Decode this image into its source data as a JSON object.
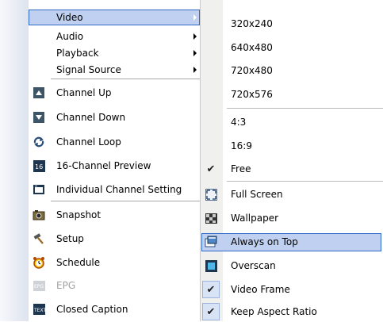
{
  "main_menu": {
    "video": "Video",
    "audio": "Audio",
    "playback": "Playback",
    "signal_source": "Signal Source",
    "channel_up": "Channel Up",
    "channel_down": "Channel Down",
    "channel_loop": "Channel Loop",
    "preview16": "16-Channel Preview",
    "individual": "Individual Channel Setting",
    "snapshot": "Snapshot",
    "setup": "Setup",
    "schedule": "Schedule",
    "epg": "EPG",
    "closed_caption": "Closed Caption"
  },
  "sub_menu": {
    "res1": "320x240",
    "res2": "640x480",
    "res3": "720x480",
    "res4": "720x576",
    "ratio1": "4:3",
    "ratio2": "16:9",
    "free": "Free",
    "full_screen": "Full Screen",
    "wallpaper": "Wallpaper",
    "always_on_top": "Always on Top",
    "overscan": "Overscan",
    "video_frame": "Video Frame",
    "keep_aspect": "Keep Aspect Ratio"
  },
  "icons": {
    "channel_up": "channel-up-icon",
    "channel_down": "channel-down-icon",
    "channel_loop": "channel-loop-icon",
    "preview16": "sixteen-channel-icon",
    "individual": "channel-setting-icon",
    "snapshot": "camera-icon",
    "setup": "hammer-icon",
    "schedule": "alarm-clock-icon",
    "epg": "epg-icon",
    "closed_caption": "text-icon",
    "full_screen": "fullscreen-icon",
    "wallpaper": "wallpaper-icon",
    "always_on_top": "always-on-top-icon",
    "overscan": "overscan-icon"
  },
  "colors": {
    "highlight_fill": "#bfd0f1",
    "highlight_border": "#3169c6"
  }
}
